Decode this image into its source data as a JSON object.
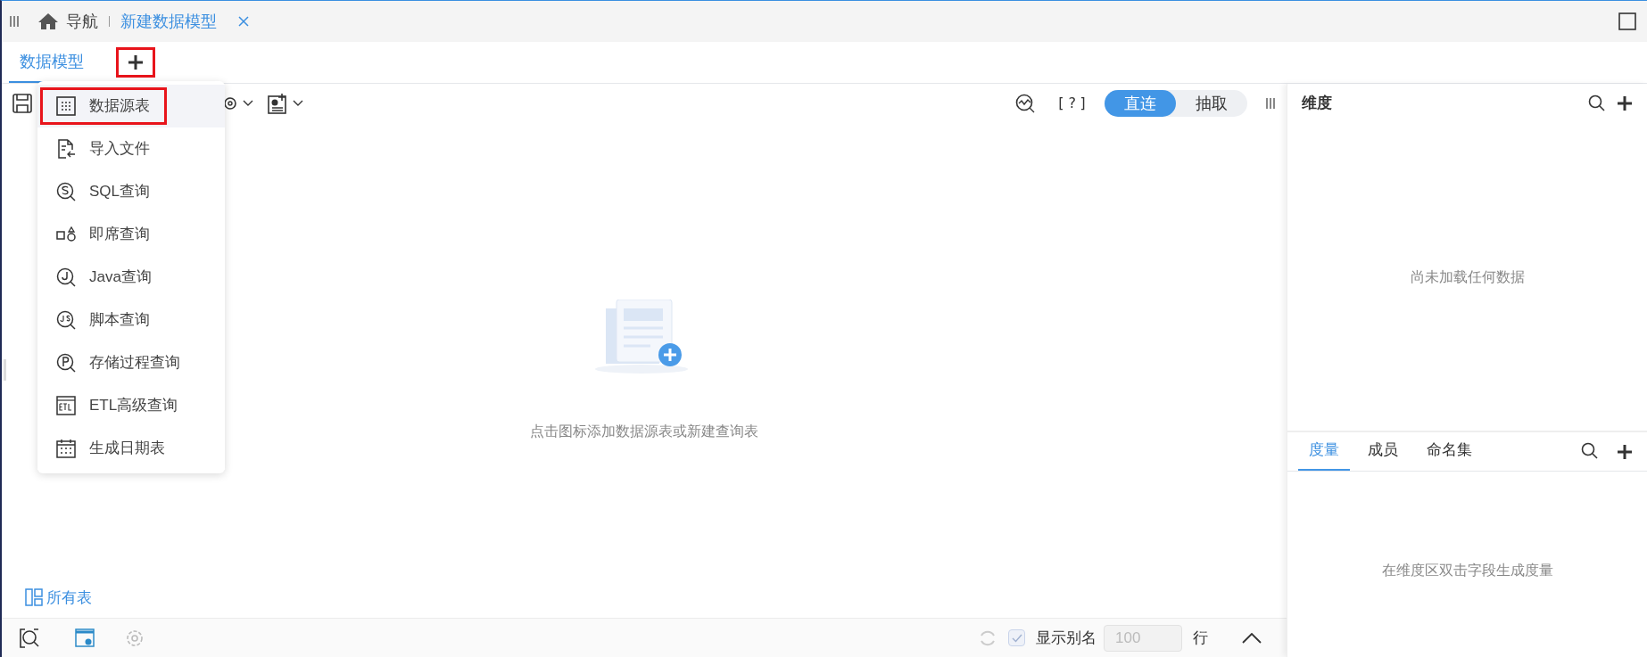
{
  "nav_tabs": [
    {
      "kind": "home",
      "label": "导航",
      "selected": false,
      "closable": false
    },
    {
      "kind": "page",
      "label": "新建数据模型",
      "selected": true,
      "closable": true
    }
  ],
  "model_tabs": {
    "tabs": [
      {
        "label": "数据模型",
        "selected": true
      }
    ],
    "add_button": {
      "annotated": true
    }
  },
  "add_menu": {
    "items": [
      {
        "kind": "table",
        "label": "数据源表",
        "selected": true,
        "annotated": true
      },
      {
        "kind": "import",
        "label": "导入文件",
        "selected": false,
        "annotated": false
      },
      {
        "kind": "sql",
        "label": "SQL查询",
        "selected": false,
        "annotated": false
      },
      {
        "kind": "adhoc",
        "label": "即席查询",
        "selected": false,
        "annotated": false
      },
      {
        "kind": "java",
        "label": "Java查询",
        "selected": false,
        "annotated": false
      },
      {
        "kind": "script",
        "label": "脚本查询",
        "selected": false,
        "annotated": false
      },
      {
        "kind": "proc",
        "label": "存储过程查询",
        "selected": false,
        "annotated": false
      },
      {
        "kind": "etl",
        "label": "ETL高级查询",
        "selected": false,
        "annotated": false
      },
      {
        "kind": "calendar",
        "label": "生成日期表",
        "selected": false,
        "annotated": false
      }
    ]
  },
  "toolbar": {
    "help": "[?]",
    "mode": [
      {
        "label": "直连",
        "selected": true
      },
      {
        "label": "抽取",
        "selected": false
      }
    ]
  },
  "canvas": {
    "empty_text": "点击图标添加数据源表或新建查询表",
    "all_tables": "所有表"
  },
  "bottom_bar": {
    "show_alias": {
      "label": "显示别名",
      "checked": true,
      "disabled": true
    },
    "row_count": {
      "value": "100",
      "disabled": true
    },
    "unit": "行"
  },
  "dimension_panel": {
    "title": "维度",
    "empty_text": "尚未加载任何数据"
  },
  "measure_panel": {
    "tabs": [
      {
        "label": "度量",
        "selected": true
      },
      {
        "label": "成员",
        "selected": false
      },
      {
        "label": "命名集",
        "selected": false
      }
    ],
    "empty_text": "在维度区双击字段生成度量"
  }
}
